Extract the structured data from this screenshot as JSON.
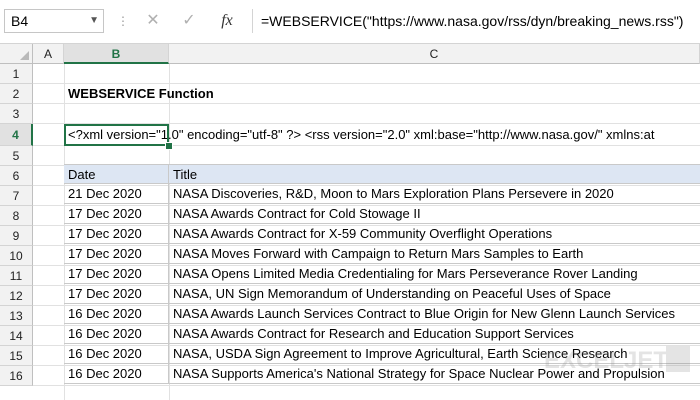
{
  "formula_bar": {
    "name_box": "B4",
    "name_box_dropdown_icon": "chevron-down-icon",
    "cancel_icon": "✕",
    "enter_icon": "✓",
    "fx_icon": "fx",
    "formula": "=WEBSERVICE(\"https://www.nasa.gov/rss/dyn/breaking_news.rss\")"
  },
  "columns": [
    "A",
    "B",
    "C"
  ],
  "rows": [
    "1",
    "2",
    "3",
    "4",
    "5",
    "6",
    "7",
    "8",
    "9",
    "10",
    "11",
    "12",
    "13",
    "14",
    "15",
    "16"
  ],
  "sheet": {
    "title": "WEBSERVICE Function",
    "xml_text": "<?xml version=\"1.0\" encoding=\"utf-8\" ?> <rss version=\"2.0\" xml:base=\"http://www.nasa.gov/\" xmlns:at"
  },
  "table": {
    "headers": {
      "date": "Date",
      "title": "Title"
    },
    "rows": [
      {
        "date": "21 Dec 2020",
        "title": "NASA Discoveries, R&D, Moon to Mars Exploration Plans Persevere in 2020"
      },
      {
        "date": "17 Dec 2020",
        "title": "NASA Awards Contract for Cold Stowage II"
      },
      {
        "date": "17 Dec 2020",
        "title": "NASA Awards Contract for X-59 Community Overflight Operations"
      },
      {
        "date": "17 Dec 2020",
        "title": "NASA Moves Forward with Campaign to Return Mars Samples to Earth"
      },
      {
        "date": "17 Dec 2020",
        "title": "NASA Opens Limited Media Credentialing for Mars Perseverance Rover Landing"
      },
      {
        "date": "17 Dec 2020",
        "title": "NASA, UN Sign Memorandum of Understanding on Peaceful Uses of Space"
      },
      {
        "date": "16 Dec 2020",
        "title": "NASA Awards Launch Services Contract to Blue Origin for New Glenn Launch Services"
      },
      {
        "date": "16 Dec 2020",
        "title": "NASA Awards Contract for Research and Education Support Services"
      },
      {
        "date": "16 Dec 2020",
        "title": "NASA, USDA Sign Agreement to Improve Agricultural, Earth Science Research"
      },
      {
        "date": "16 Dec 2020",
        "title": "NASA Supports America's National Strategy for Space Nuclear Power and Propulsion"
      }
    ]
  },
  "watermark": {
    "text": "EXCELJET"
  },
  "colors": {
    "accent": "#217346",
    "table_header": "#dde6f3",
    "grid": "#e1e1e1"
  }
}
